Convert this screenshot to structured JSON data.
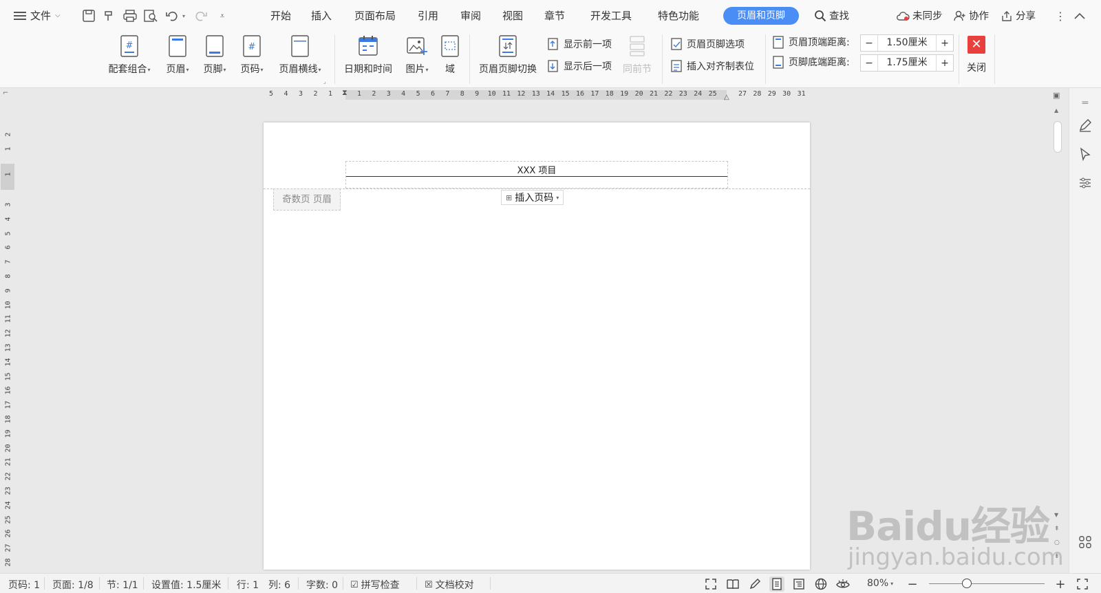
{
  "menubar": {
    "file_label": "文件",
    "tabs": [
      "开始",
      "插入",
      "页面布局",
      "引用",
      "审阅",
      "视图",
      "章节",
      "开发工具",
      "特色功能"
    ],
    "active_tab": "页眉和页脚",
    "search_label": "查找",
    "sync_label": "未同步",
    "collab_label": "协作",
    "share_label": "分享"
  },
  "ribbon": {
    "combo": "配套组合",
    "header": "页眉",
    "footer": "页脚",
    "page_num": "页码",
    "header_line": "页眉横线",
    "datetime": "日期和时间",
    "picture": "图片",
    "field": "域",
    "switch": "页眉页脚切换",
    "show_prev": "显示前一项",
    "show_next": "显示后一项",
    "same_as_prev": "同前节",
    "hf_options": "页眉页脚选项",
    "align_tab": "插入对齐制表位",
    "top_dist_label": "页眉顶端距离:",
    "top_dist_value": "1.50厘米",
    "bottom_dist_label": "页脚底端距离:",
    "bottom_dist_value": "1.75厘米",
    "minus": "−",
    "plus": "+",
    "close": "关闭"
  },
  "hruler": [
    "5",
    "4",
    "3",
    "2",
    "1",
    "1",
    "2",
    "3",
    "4",
    "5",
    "6",
    "7",
    "8",
    "9",
    "10",
    "11",
    "12",
    "13",
    "14",
    "15",
    "16",
    "17",
    "18",
    "19",
    "20",
    "21",
    "22",
    "23",
    "24",
    "25",
    "27",
    "28",
    "29",
    "30",
    "31"
  ],
  "vruler": [
    "2",
    "1",
    "1",
    "3",
    "4",
    "5",
    "6",
    "7",
    "8",
    "9",
    "10",
    "11",
    "12",
    "13",
    "14",
    "15",
    "16",
    "17",
    "18",
    "19",
    "20",
    "21",
    "22",
    "23",
    "24",
    "25",
    "26",
    "27",
    "28"
  ],
  "document": {
    "header_text": "XXX 项目",
    "odd_page_tag": "奇数页 页眉",
    "insert_page_num": "插入页码"
  },
  "status": {
    "page_code": "页码: 1",
    "page": "页面: 1/8",
    "section": "节: 1/1",
    "setting": "设置值: 1.5厘米",
    "row": "行: 1",
    "col": "列: 6",
    "words": "字数: 0",
    "spell": "拼写检查",
    "proof": "文档校对",
    "zoom": "80%"
  },
  "watermark": {
    "main": "Baidu经验",
    "sub": "jingyan.baidu.com"
  },
  "colors": {
    "accent": "#4a8df5",
    "close": "#e8403d",
    "page_bg": "#e9e9ea"
  }
}
